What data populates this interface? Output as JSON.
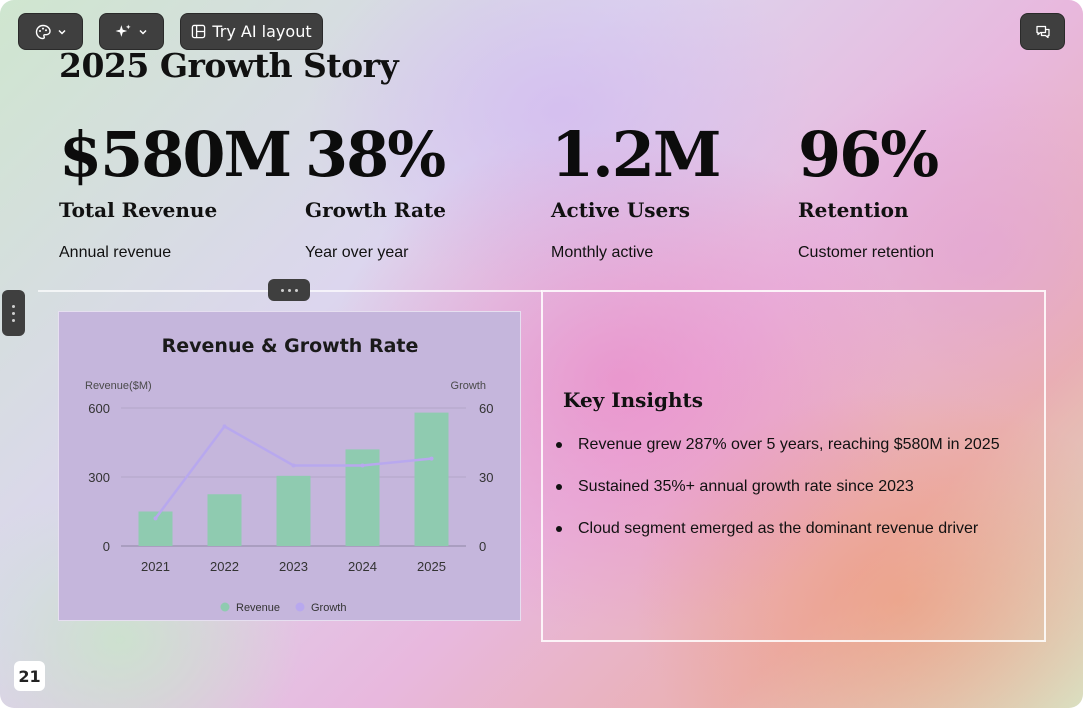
{
  "toolbar": {
    "theme_icon": "palette-icon",
    "ai_icon": "sparkles-icon",
    "layout_icon": "layout-icon",
    "layout_label": "Try AI layout",
    "comments_icon": "comments-icon"
  },
  "slide": {
    "title": "2025 Growth Story",
    "page_number": "21",
    "stats": [
      {
        "value": "$580M",
        "label": "Total Revenue",
        "sub": "Annual revenue"
      },
      {
        "value": "38%",
        "label": "Growth Rate",
        "sub": "Year over year"
      },
      {
        "value": "1.2M",
        "label": "Active Users",
        "sub": "Monthly active"
      },
      {
        "value": "96%",
        "label": "Retention",
        "sub": "Customer retention"
      }
    ],
    "insights": {
      "title": "Key Insights",
      "items": [
        "Revenue grew 287% over 5 years, reaching $580M in 2025",
        "Sustained 35%+ annual growth rate since 2023",
        "Cloud segment emerged as the dominant revenue driver"
      ]
    }
  },
  "colors": {
    "bar": "#8fcbb0",
    "line": "#b8a8ee",
    "card_bg": "#c5b6dc",
    "toolbar_bg": "#3f3f3f"
  },
  "chart_data": {
    "type": "bar",
    "title": "Revenue & Growth Rate",
    "categories": [
      "2021",
      "2022",
      "2023",
      "2024",
      "2025"
    ],
    "series": [
      {
        "name": "Revenue",
        "type": "bar",
        "axis": "left",
        "values": [
          150,
          225,
          305,
          420,
          580
        ]
      },
      {
        "name": "Growth",
        "type": "line",
        "axis": "right",
        "values": [
          12,
          52,
          35,
          35,
          38
        ]
      }
    ],
    "ylabel": "Revenue($M)",
    "y2label": "Growth",
    "ylim": [
      0,
      600
    ],
    "y2lim": [
      0,
      60
    ],
    "yticks": [
      "0",
      "300",
      "600"
    ],
    "y2ticks": [
      "0",
      "30",
      "60"
    ],
    "legend": "bottom",
    "grid": true
  }
}
